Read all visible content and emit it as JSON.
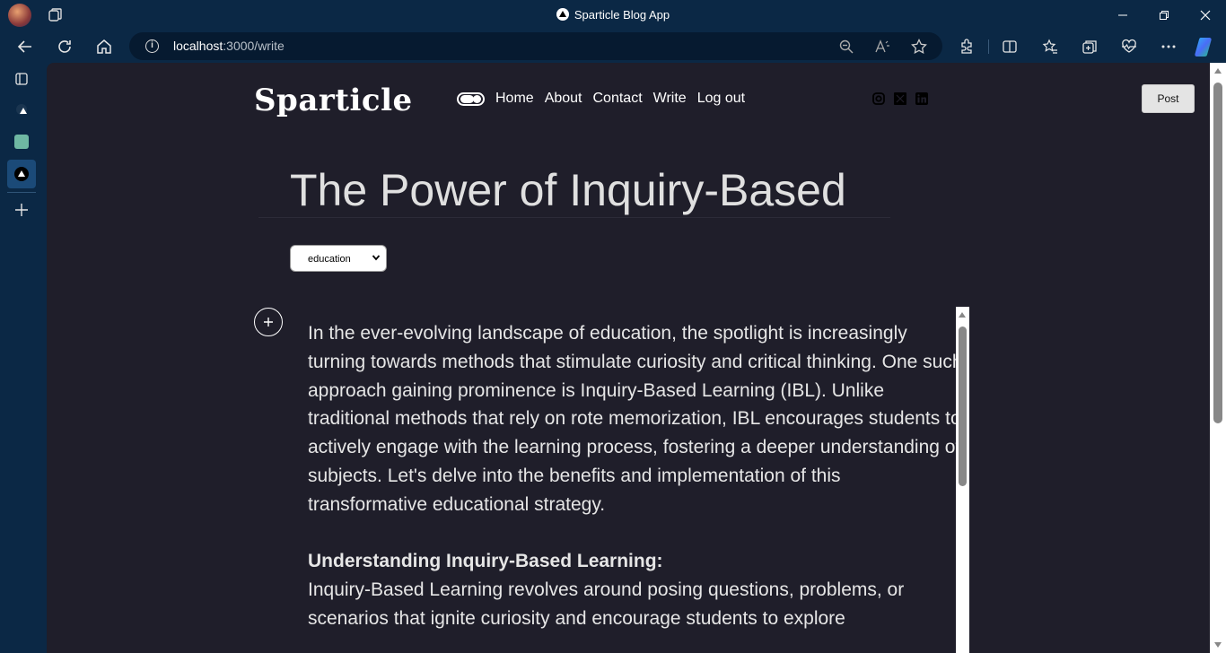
{
  "browser": {
    "window_title": "Sparticle Blog App",
    "url_host": "localhost",
    "url_rest": ":3000/write"
  },
  "site": {
    "logo": "Sparticle",
    "nav": [
      "Home",
      "About",
      "Contact",
      "Write",
      "Log out"
    ],
    "post_label": "Post"
  },
  "write": {
    "title": "The Power of Inquiry-Based",
    "category": "education",
    "paragraph1": "In the ever-evolving landscape of education, the spotlight is increasingly turning towards methods that stimulate curiosity and critical thinking. One such approach gaining prominence is Inquiry-Based Learning (IBL). Unlike traditional methods that rely on rote memorization, IBL encourages students to actively engage with the learning process, fostering a deeper understanding of subjects. Let's delve into the benefits and implementation of this transformative educational strategy.",
    "heading1": "Understanding Inquiry-Based Learning:",
    "paragraph2": "Inquiry-Based Learning revolves around posing questions, problems, or scenarios that ignite curiosity and encourage students to explore"
  }
}
